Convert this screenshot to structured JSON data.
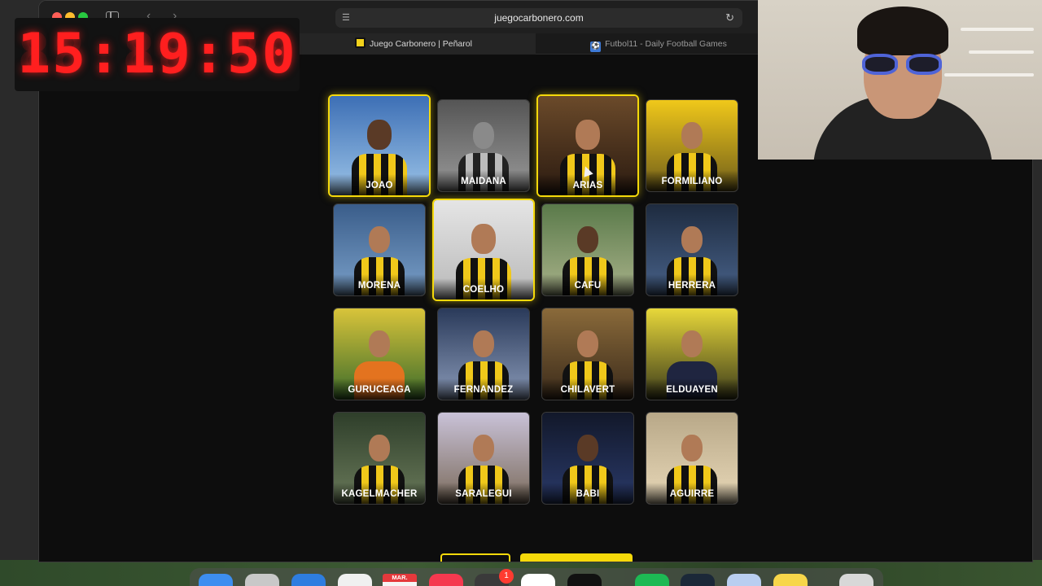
{
  "browser": {
    "url": "juegocarbonero.com",
    "tabs": [
      {
        "label": "Juego Carbonero | Peñarol",
        "active": true
      },
      {
        "label": "Futbol11 - Daily Football Games",
        "active": false
      }
    ]
  },
  "timer": {
    "display": "15:19:50",
    "color": "#ff1f1f"
  },
  "accent_color": "#f5d90a",
  "players": [
    {
      "name": "JOAO",
      "selected": true
    },
    {
      "name": "MAIDANA",
      "selected": false
    },
    {
      "name": "ARIAS",
      "selected": true
    },
    {
      "name": "FORMILIANO",
      "selected": false
    },
    {
      "name": "MORENA",
      "selected": false
    },
    {
      "name": "COELHO",
      "selected": true
    },
    {
      "name": "CAFU",
      "selected": false
    },
    {
      "name": "HERRERA",
      "selected": false
    },
    {
      "name": "GURUCEAGA",
      "selected": false
    },
    {
      "name": "FERNANDEZ",
      "selected": false
    },
    {
      "name": "CHILAVERT",
      "selected": false
    },
    {
      "name": "ELDUAYEN",
      "selected": false
    },
    {
      "name": "KAGELMACHER",
      "selected": false
    },
    {
      "name": "SARALEGUI",
      "selected": false
    },
    {
      "name": "BABI",
      "selected": false
    },
    {
      "name": "AGUIRRE",
      "selected": false
    }
  ],
  "dock": {
    "calendar_month": "MAR.",
    "notification_count": "1",
    "apps": [
      "finder-icon",
      "launchpad-icon",
      "safari-icon",
      "photos-icon",
      "calendar-icon",
      "music-icon",
      "chatgpt-icon",
      "slack-icon",
      "x-icon",
      "spotify-icon",
      "steam-icon",
      "preview-icon",
      "notes-icon",
      "trash-icon"
    ]
  }
}
